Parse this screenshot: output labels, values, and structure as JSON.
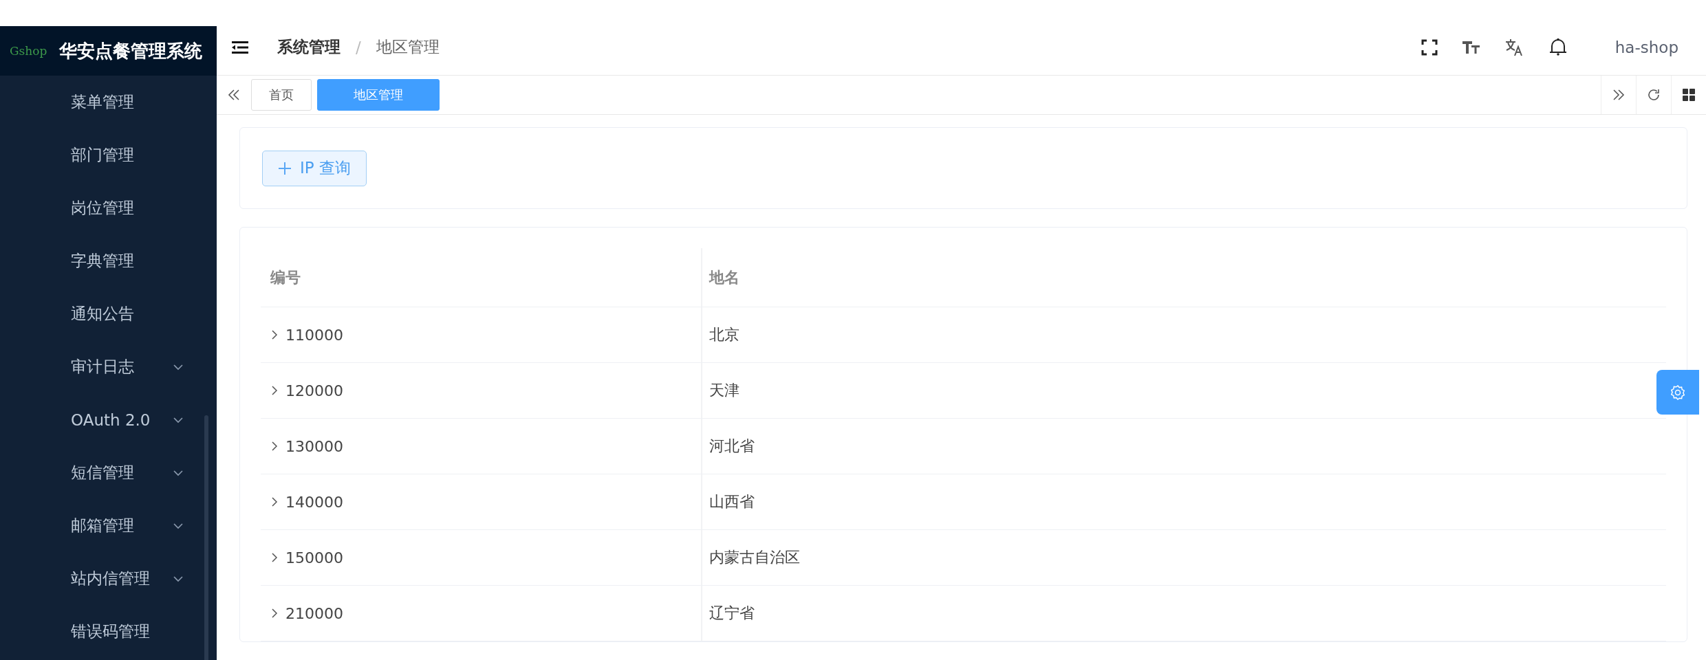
{
  "app": {
    "logo": "Gshop",
    "title": "华安点餐管理系统"
  },
  "sidebar": {
    "items": [
      {
        "label": "菜单管理",
        "expandable": false
      },
      {
        "label": "部门管理",
        "expandable": false
      },
      {
        "label": "岗位管理",
        "expandable": false
      },
      {
        "label": "字典管理",
        "expandable": false
      },
      {
        "label": "通知公告",
        "expandable": false
      },
      {
        "label": "审计日志",
        "expandable": true
      },
      {
        "label": "OAuth 2.0",
        "expandable": true
      },
      {
        "label": "短信管理",
        "expandable": true
      },
      {
        "label": "邮箱管理",
        "expandable": true
      },
      {
        "label": "站内信管理",
        "expandable": true
      },
      {
        "label": "错误码管理",
        "expandable": false
      }
    ]
  },
  "header": {
    "breadcrumb": [
      "系统管理",
      "地区管理"
    ],
    "separator": "/",
    "user": "ha-shop"
  },
  "tabs": [
    {
      "label": "首页",
      "selected": false
    },
    {
      "label": "地区管理",
      "selected": true
    }
  ],
  "toolbar": {
    "button": "IP 查询"
  },
  "table": {
    "columns": [
      "编号",
      "地名"
    ],
    "rows": [
      {
        "code": "110000",
        "name": "北京",
        "expanded": false
      },
      {
        "code": "120000",
        "name": "天津",
        "expanded": false
      },
      {
        "code": "130000",
        "name": "河北省",
        "expanded": false
      },
      {
        "code": "140000",
        "name": "山西省",
        "expanded": false
      },
      {
        "code": "150000",
        "name": "内蒙古自治区",
        "expanded": false
      },
      {
        "code": "210000",
        "name": "辽宁省",
        "expanded": false
      }
    ]
  }
}
